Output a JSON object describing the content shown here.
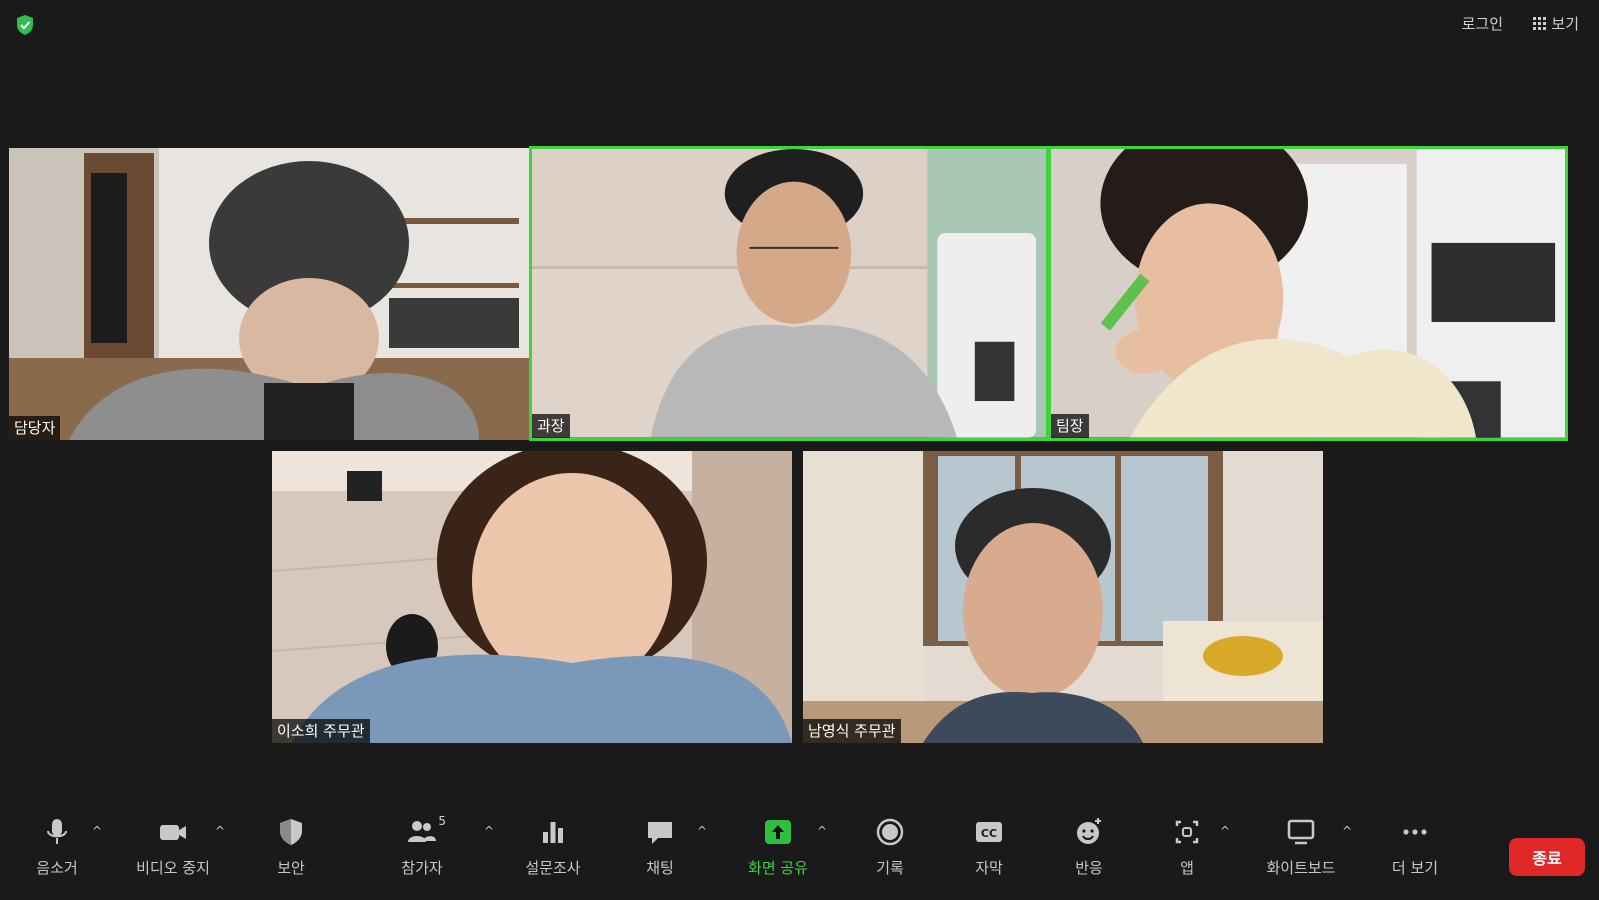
{
  "topbar": {
    "login_label": "로그인",
    "view_label": "보기"
  },
  "participants": [
    {
      "name": "담당자",
      "speaking": false
    },
    {
      "name": "과장",
      "speaking": true
    },
    {
      "name": "팀장",
      "speaking": true
    },
    {
      "name": "이소희 주무관",
      "speaking": false
    },
    {
      "name": "남영식 주무관",
      "speaking": false
    }
  ],
  "toolbar": {
    "mute_label": "음소거",
    "video_label": "비디오 중지",
    "security_label": "보안",
    "participants_label": "참가자",
    "participants_count": "5",
    "polls_label": "설문조사",
    "chat_label": "채팅",
    "share_label": "화면 공유",
    "record_label": "기록",
    "cc_label": "자막",
    "cc_icon_text": "CC",
    "reactions_label": "반응",
    "apps_label": "앱",
    "whiteboard_label": "화이트보드",
    "more_label": "더 보기",
    "end_label": "종료"
  },
  "colors": {
    "background": "#1a1a1a",
    "speaking_border": "#3fd33f",
    "share_green": "#3fd33f",
    "end_red": "#e02828"
  }
}
